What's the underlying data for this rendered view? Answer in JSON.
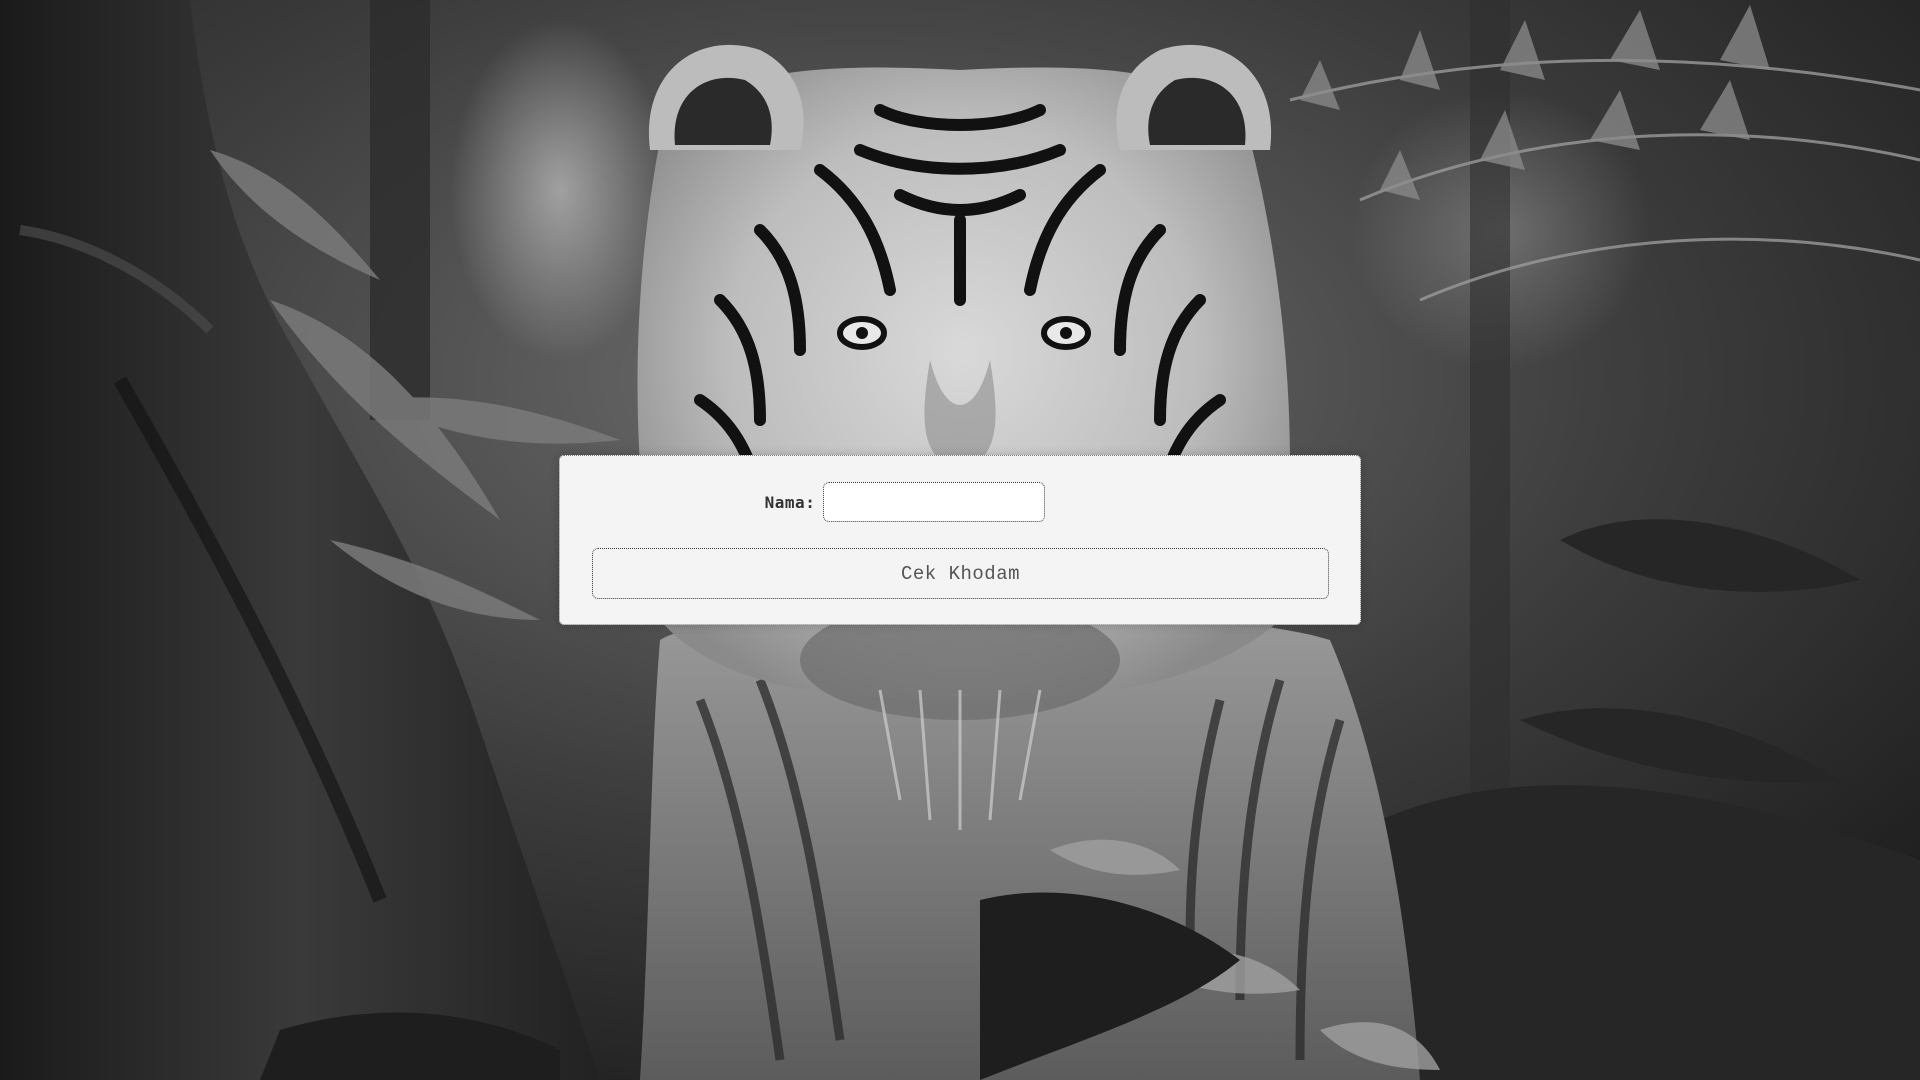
{
  "form": {
    "name_label": "Nama:",
    "name_value": "",
    "name_placeholder": "",
    "submit_label": "Cek Khodam"
  },
  "background": {
    "subject": "tiger-in-jungle",
    "palette": "grayscale"
  }
}
